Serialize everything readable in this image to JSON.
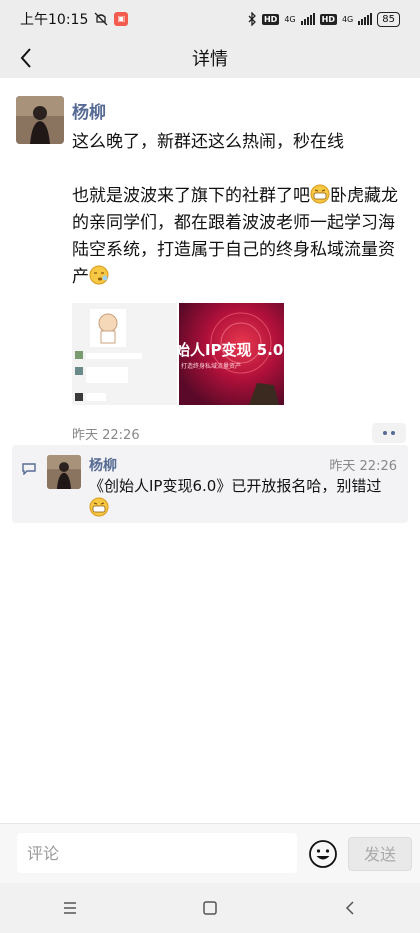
{
  "status_bar": {
    "time": "上午10:15",
    "network_1": "4G",
    "network_2": "4G",
    "hd_1": "HD",
    "hd_2": "HD",
    "battery": "85"
  },
  "navbar": {
    "title": "详情"
  },
  "post": {
    "author": "杨柳",
    "text_line_1": "这么晚了，新群还这么热闹，秒在线",
    "text_para_2a": "也就是波波来了旗下的社群了吧",
    "text_para_2b": "卧虎藏龙的亲同学们，都在跟着波波老师一起学习海陆空系统，打造属于自己的终身私域流量资产",
    "image2_text": "始人IP变现 5.0",
    "image2_subtext": "打造终身私域流量资产",
    "time": "昨天 22:26"
  },
  "comments": [
    {
      "author": "杨柳",
      "time": "昨天 22:26",
      "text": "《创始人IP变现6.0》已开放报名哈，别错过"
    }
  ],
  "input_bar": {
    "placeholder": "评论",
    "send_label": "发送"
  },
  "colors": {
    "link_blue": "#576b95",
    "bg_gray": "#ededed"
  }
}
